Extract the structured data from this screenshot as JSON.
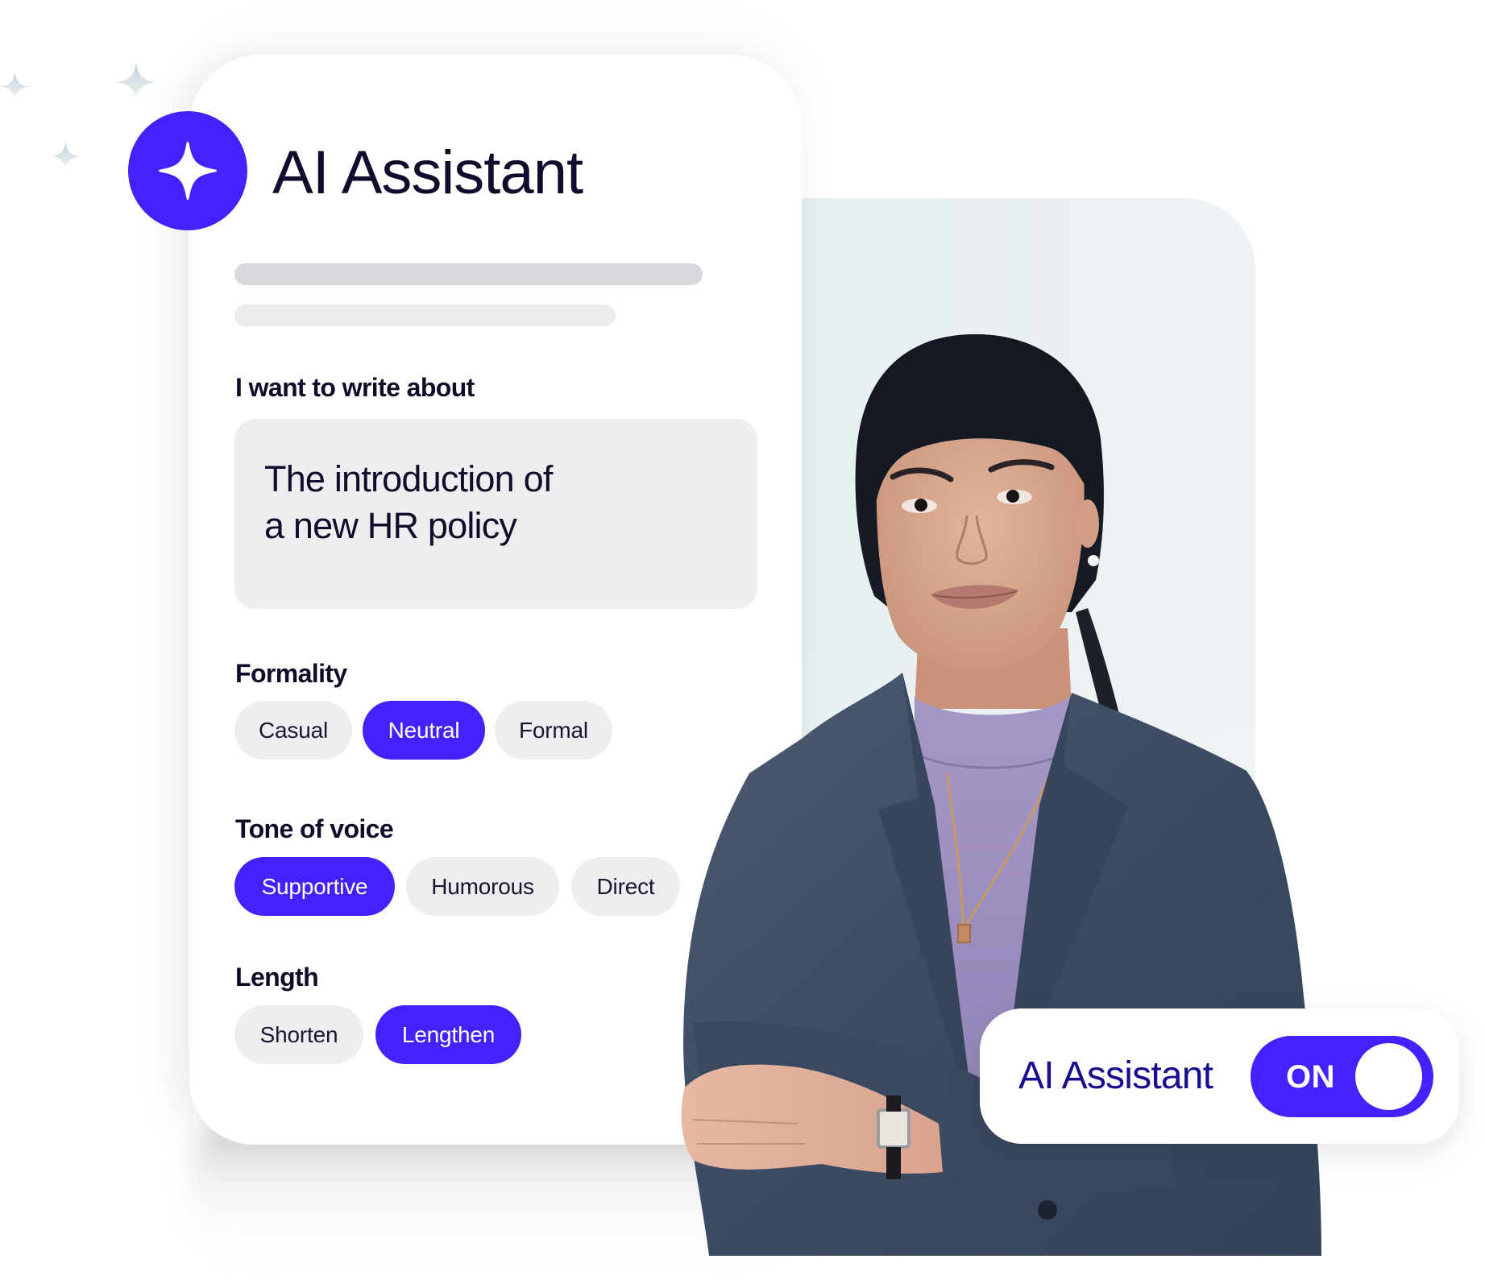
{
  "colors": {
    "accent": "#4521ff",
    "text_dark": "#120b2b",
    "toggle_label": "#170d8f",
    "chip_bg": "#eeeef0",
    "skeleton_1": "#d9d8de",
    "skeleton_2": "#ececef"
  },
  "panel": {
    "icon": "sparkle-icon",
    "title": "AI Assistant",
    "prompt_label": "I want to write about",
    "prompt_value": "The introduction of\na new HR policy",
    "sections": [
      {
        "label": "Formality",
        "options": [
          {
            "label": "Casual",
            "selected": false
          },
          {
            "label": "Neutral",
            "selected": true
          },
          {
            "label": "Formal",
            "selected": false
          }
        ]
      },
      {
        "label": "Tone of voice",
        "options": [
          {
            "label": "Supportive",
            "selected": true
          },
          {
            "label": "Humorous",
            "selected": false
          },
          {
            "label": "Direct",
            "selected": false
          }
        ]
      },
      {
        "label": "Length",
        "options": [
          {
            "label": "Shorten",
            "selected": false
          },
          {
            "label": "Lengthen",
            "selected": true
          }
        ]
      }
    ]
  },
  "toggle": {
    "label": "AI Assistant",
    "state_text": "ON",
    "on": true
  },
  "photo": {
    "subject": "smiling woman with dark bangs in grey blazer and lavender turtleneck, arms crossed"
  }
}
